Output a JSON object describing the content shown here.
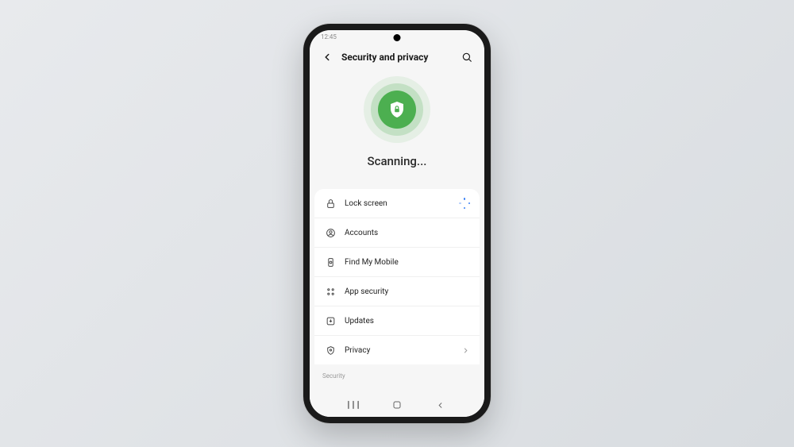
{
  "statusbar": {
    "time": "12:45"
  },
  "header": {
    "title": "Security and privacy"
  },
  "hero": {
    "status_text": "Scanning..."
  },
  "list": {
    "items": [
      {
        "label": "Lock screen",
        "icon": "lock-icon",
        "trailing": "loading"
      },
      {
        "label": "Accounts",
        "icon": "account-icon",
        "trailing": "none"
      },
      {
        "label": "Find My Mobile",
        "icon": "locate-icon",
        "trailing": "none"
      },
      {
        "label": "App security",
        "icon": "apps-icon",
        "trailing": "none"
      },
      {
        "label": "Updates",
        "icon": "update-icon",
        "trailing": "none"
      },
      {
        "label": "Privacy",
        "icon": "privacy-icon",
        "trailing": "chevron"
      }
    ]
  },
  "section": {
    "security_label": "Security"
  },
  "colors": {
    "accent": "#4CAF50"
  }
}
